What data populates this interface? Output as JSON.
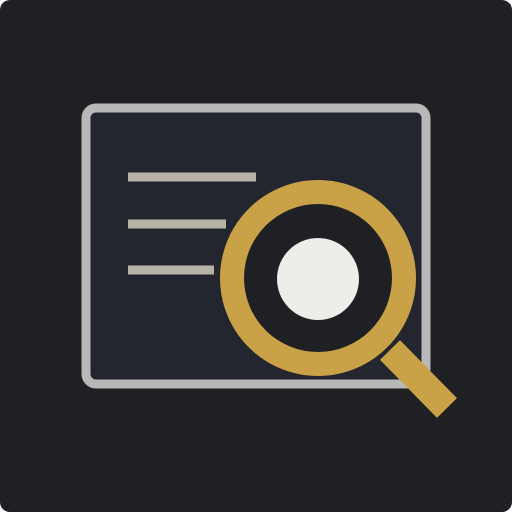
{
  "icon": {
    "name": "document-search-icon",
    "colors": {
      "tile_background": "#1f2023",
      "document_fill": "#23262f",
      "document_border": "#b8b8b8",
      "text_lines": "#b8b3a8",
      "magnifier_ring": "#c9a146",
      "lens_inner": "#1f2023",
      "lens_glint": "#eeedea"
    }
  }
}
